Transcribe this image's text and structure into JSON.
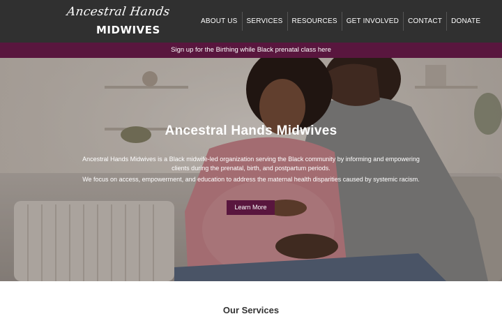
{
  "header": {
    "logo": {
      "script_text": "Ancestral Hands",
      "block_text": "MIDWIVES"
    },
    "nav": [
      {
        "label": "ABOUT US"
      },
      {
        "label": "SERVICES"
      },
      {
        "label": "RESOURCES"
      },
      {
        "label": "GET INVOLVED"
      },
      {
        "label": "CONTACT"
      },
      {
        "label": "DONATE"
      }
    ]
  },
  "banner": {
    "text": "Sign up for the Birthing while Black prenatal class here"
  },
  "hero": {
    "title": "Ancestral Hands Midwives",
    "paragraph1": "Ancestral Hands Midwives is a Black midwife-led organization serving the Black community by informing and empowering clients during the prenatal, birth, and postpartum periods.",
    "paragraph2": "We focus on access, empowerment, and education to address the maternal health disparities caused by systemic racism.",
    "button_label": "Learn More"
  },
  "services": {
    "title": "Our Services"
  },
  "colors": {
    "header_bg": "#303030",
    "accent": "#59163e",
    "text_light": "#ffffff"
  }
}
